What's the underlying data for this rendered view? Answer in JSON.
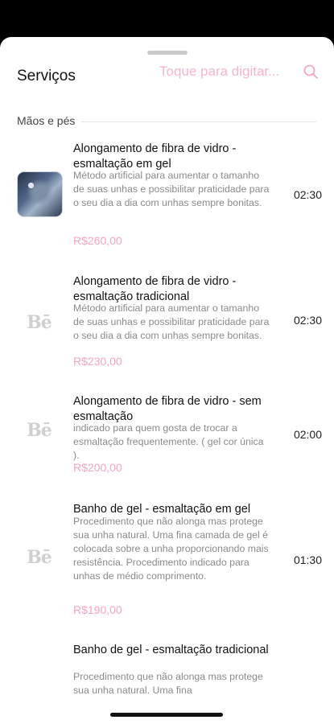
{
  "header": {
    "title": "Serviços",
    "search_placeholder": "Toque para digitar..."
  },
  "section": {
    "title": "Mãos e pés"
  },
  "services": [
    {
      "name": "Alongamento de fibra de vidro - esmaltação em gel",
      "description": "Método artificial para aumentar o tamanho de suas unhas e possibilitar praticidade para o seu dia a dia com unhas sempre bonitas.",
      "price": "R$260,00",
      "duration": "02:30",
      "thumb": "nail-photo"
    },
    {
      "name": "Alongamento de fibra de vidro - esmaltação tradicional",
      "description": "Método artificial para aumentar o tamanho de suas unhas e possibilitar praticidade para o seu dia a dia com unhas sempre bonitas.",
      "price": "R$230,00",
      "duration": "02:30",
      "thumb": "brand-logo",
      "logo_text": "Bē"
    },
    {
      "name": "Alongamento de fibra de vidro - sem esmaltação",
      "description": "indicado para quem gosta de trocar a esmaltação frequentemente. ( gel cor única ).",
      "price": "R$200,00",
      "duration": "02:00",
      "thumb": "brand-logo",
      "logo_text": "Bē"
    },
    {
      "name": "Banho de gel - esmaltação em gel",
      "description": "Procedimento que não alonga mas protege sua unha natural. Uma fina camada de gel é colocada sobre a unha proporcionando mais resistência. Procedimento indicado para unhas de médio comprimento.",
      "price": "R$190,00",
      "duration": "01:30",
      "thumb": "brand-logo",
      "logo_text": "Bē"
    },
    {
      "name": "Banho de gel - esmaltação tradicional",
      "description": "Procedimento que não alonga mas protege sua unha natural. Uma fina",
      "price": "",
      "duration": "",
      "thumb": "none"
    }
  ],
  "colors": {
    "accent": "#f3a6bd",
    "placeholder": "#f4b6c8",
    "description": "#8a8a8a",
    "title": "#111111"
  }
}
